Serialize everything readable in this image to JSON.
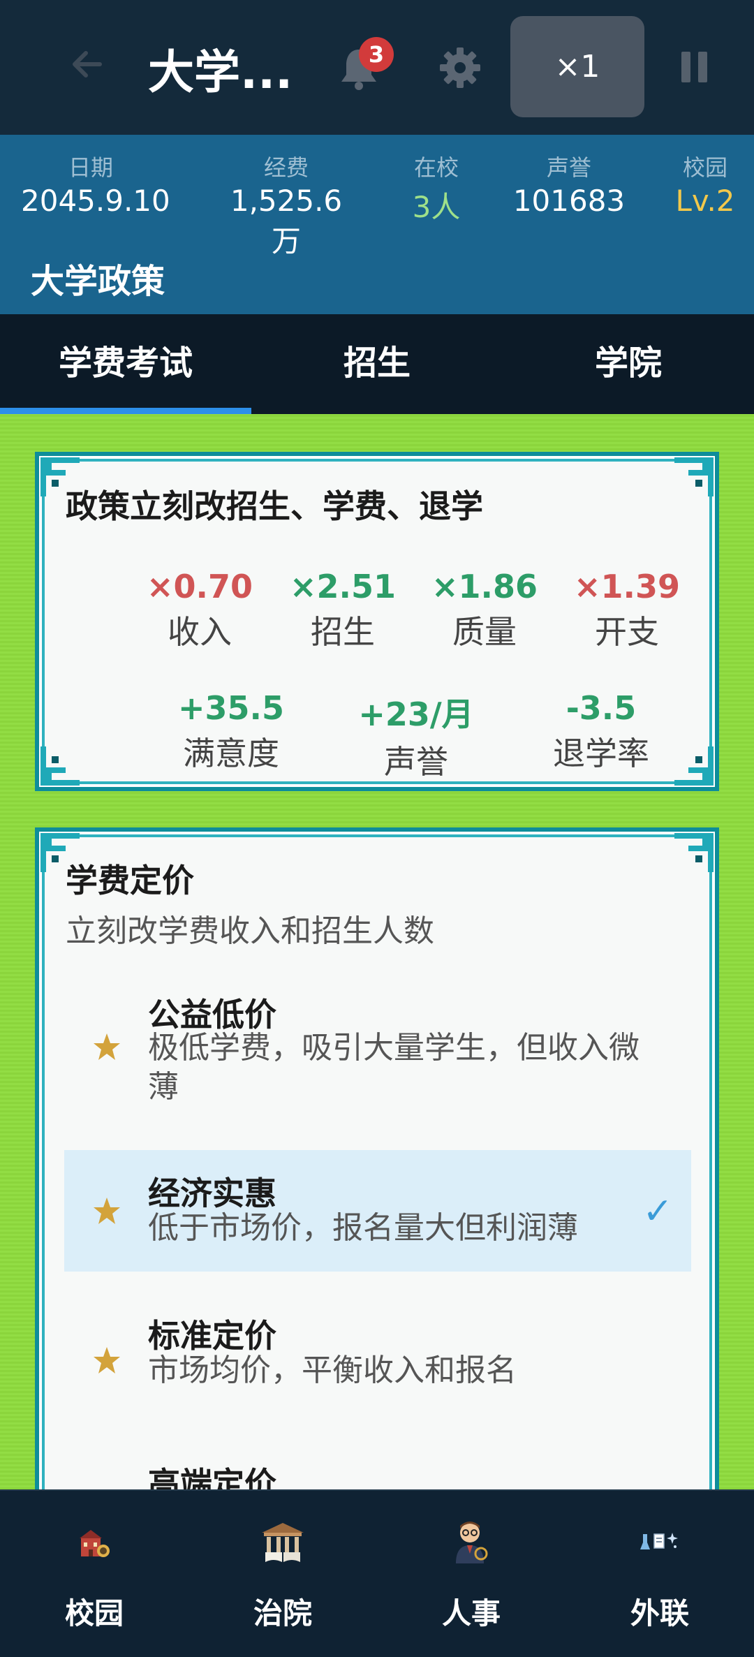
{
  "header": {
    "title": "大学...",
    "notification_count": "3",
    "speed": "×1"
  },
  "stats": {
    "date_label": "日期",
    "date_value": "2045.9.10",
    "funds_label": "经费",
    "funds_value": "1,525.6万",
    "students_label": "在校",
    "students_value": "3人",
    "prestige_label": "声誉",
    "prestige_value": "101683",
    "campus_label": "校园",
    "campus_value": "Lv.2"
  },
  "section_title": "大学政策",
  "tabs": [
    {
      "label": "学费考试",
      "active": true
    },
    {
      "label": "招生",
      "active": false
    },
    {
      "label": "学院",
      "active": false
    }
  ],
  "summary": {
    "title": "政策立刻改招生、学费、退学",
    "effects": [
      {
        "value": "×0.70",
        "label": "收入",
        "trend": "down"
      },
      {
        "value": "×2.51",
        "label": "招生",
        "trend": "up"
      },
      {
        "value": "×1.86",
        "label": "质量",
        "trend": "up"
      },
      {
        "value": "×1.39",
        "label": "开支",
        "trend": "down"
      },
      {
        "value": "+35.5",
        "label": "满意度",
        "trend": "up"
      },
      {
        "value": "+23/月",
        "label": "声誉",
        "trend": "up"
      },
      {
        "value": "-3.5",
        "label": "退学率",
        "trend": "up"
      }
    ]
  },
  "pricing": {
    "title": "学费定价",
    "subtitle": "立刻改学费收入和招生人数",
    "options": [
      {
        "name": "公益低价",
        "desc": "极低学费，吸引大量学生，但收入微薄",
        "selected": false
      },
      {
        "name": "经济实惠",
        "desc": "低于市场价，报名量大但利润薄",
        "selected": true
      },
      {
        "name": "标准定价",
        "desc": "市场均价，平衡收入和报名",
        "selected": false
      },
      {
        "name": "高端定价",
        "desc": "",
        "selected": false
      }
    ],
    "check_glyph": "✓"
  },
  "bottom_nav": [
    {
      "label": "校园",
      "icon": "campus-building-icon"
    },
    {
      "label": "治院",
      "icon": "governance-hall-icon"
    },
    {
      "label": "人事",
      "icon": "personnel-icon"
    },
    {
      "label": "外联",
      "icon": "outreach-icon"
    }
  ],
  "colors": {
    "up": "#2d9d68",
    "down": "#d05555",
    "students_value": "#9ee08a",
    "campus_value": "#f2c84b",
    "tab_indicator": "#2d8fe8",
    "grass": "#8fdc3e"
  }
}
